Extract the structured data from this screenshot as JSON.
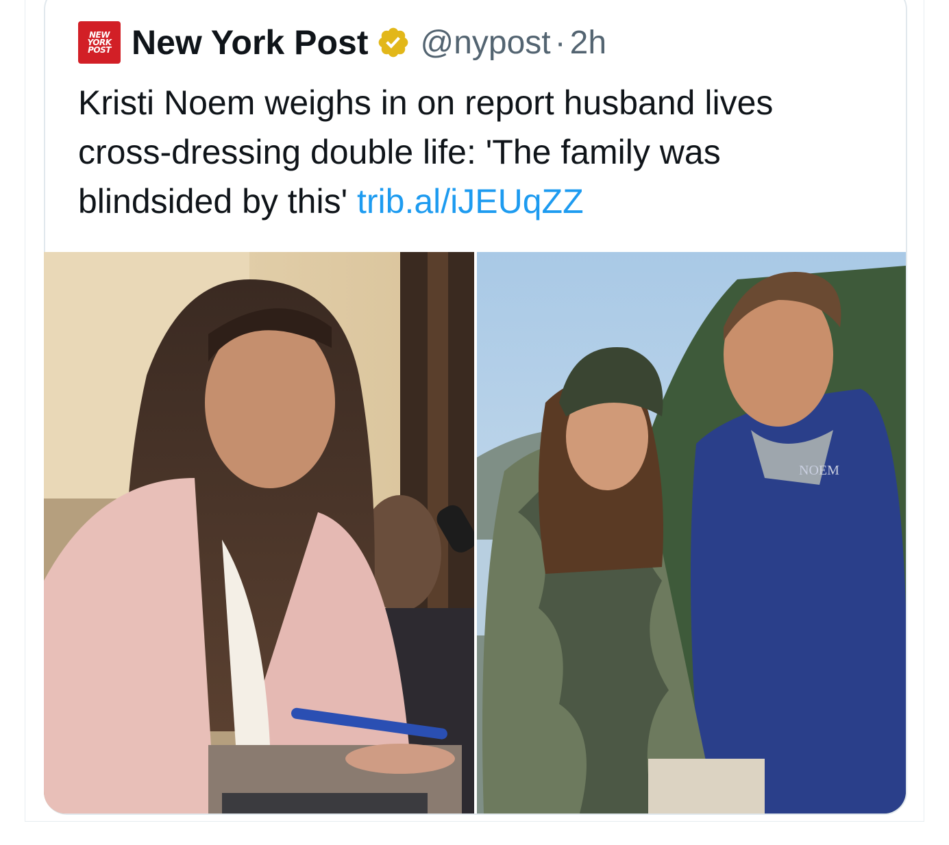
{
  "tweet": {
    "author": {
      "logo_lines": [
        "NEW",
        "YORK",
        "POST"
      ],
      "name": "New York Post",
      "handle": "@nypost",
      "separator": "·",
      "time": "2h",
      "verified_icon": "gold-checkmark-icon"
    },
    "text": "Kristi Noem weighs in on report husband lives cross-dressing double life: 'The family was blindsided by this' ",
    "link": "trib.al/iJEUqZZ",
    "media": {
      "count": 2,
      "left_photo": {
        "jacket_logo": ""
      },
      "right_photo": {
        "jacket_logo": "NOEM"
      }
    }
  },
  "colors": {
    "link": "#1d9bf0",
    "secondary_text": "#536471",
    "brand_red": "#d21f26",
    "verified_gold": "#e2b719"
  }
}
